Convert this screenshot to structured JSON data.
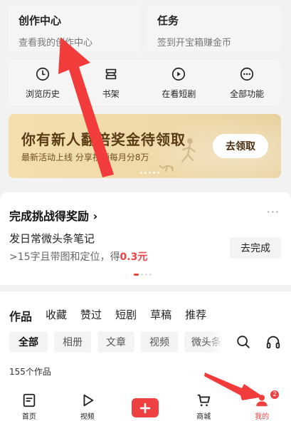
{
  "top_cards": {
    "creator": {
      "title": "创作中心",
      "subtitle": "查看我的创作中心"
    },
    "task": {
      "title": "任务",
      "subtitle": "签到开宝箱赚金币"
    }
  },
  "shortcuts": [
    {
      "label": "浏览历史",
      "icon": "history-clock-icon"
    },
    {
      "label": "书架",
      "icon": "bookshelf-icon"
    },
    {
      "label": "在看短剧",
      "icon": "play-circle-icon"
    },
    {
      "label": "全部功能",
      "icon": "more-dots-icon"
    }
  ],
  "banner": {
    "title": "你有新人翻倍奖金待领取",
    "subtitle": "最新活动上线 分享视频每月分8万",
    "button": "去领取"
  },
  "challenge": {
    "heading": "完成挑战得奖励 ›",
    "more": "···",
    "task": "发日常微头条笔记",
    "desc_prefix": ">15字且带图和定位，得",
    "reward": "0.3元",
    "button": "去完成"
  },
  "works": {
    "tabs": [
      "作品",
      "收藏",
      "赞过",
      "短剧",
      "草稿",
      "推荐"
    ],
    "filters": [
      "全部",
      "相册",
      "文章",
      "视频",
      "微头条"
    ],
    "count": "155个作品"
  },
  "tabbar": {
    "items": [
      {
        "label": "首页",
        "icon": "home-icon"
      },
      {
        "label": "视频",
        "icon": "video-play-icon"
      },
      {
        "label": "",
        "icon": "publish-plus-icon"
      },
      {
        "label": "商城",
        "icon": "cart-icon"
      },
      {
        "label": "我的",
        "icon": "profile-icon",
        "badge": "2"
      }
    ]
  },
  "colors": {
    "accent_red": "#f04142",
    "banner_gold": "#f3dfae",
    "annotation_arrow": "#f23b3b"
  }
}
